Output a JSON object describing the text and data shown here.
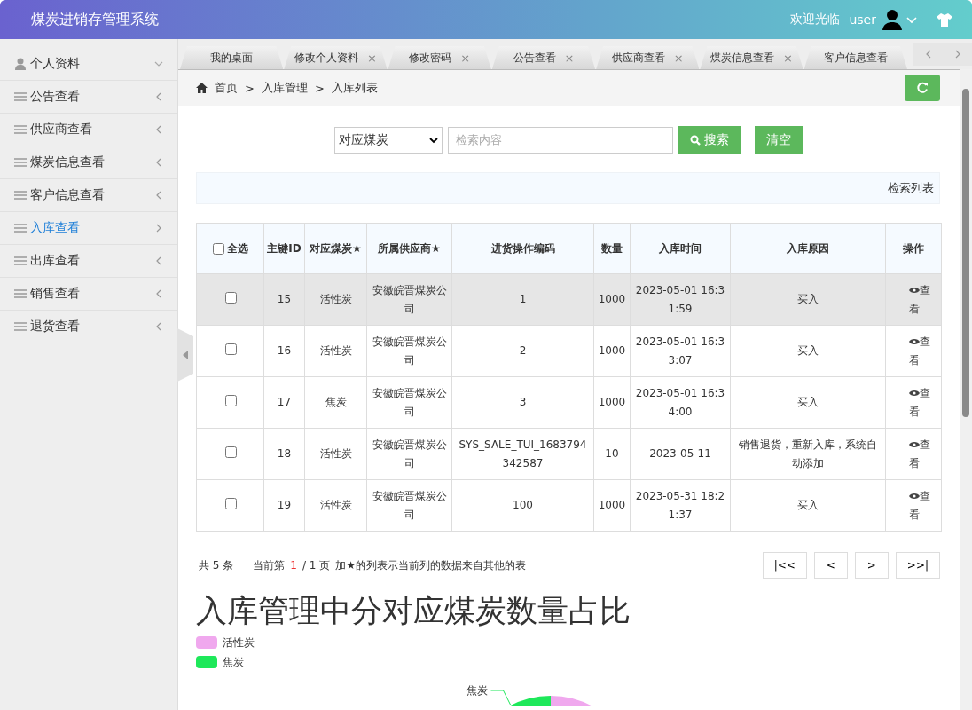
{
  "header": {
    "title": "煤炭进销存管理系统",
    "welcome": "欢迎光临",
    "user": "user"
  },
  "sidebar": {
    "items": [
      {
        "label": "个人资料",
        "kind": "profile",
        "selected": false
      },
      {
        "label": "公告查看",
        "kind": "menu",
        "selected": false
      },
      {
        "label": "供应商查看",
        "kind": "menu",
        "selected": false
      },
      {
        "label": "煤炭信息查看",
        "kind": "menu",
        "selected": false
      },
      {
        "label": "客户信息查看",
        "kind": "menu",
        "selected": false
      },
      {
        "label": "入库查看",
        "kind": "menu",
        "selected": true
      },
      {
        "label": "出库查看",
        "kind": "menu",
        "selected": false
      },
      {
        "label": "销售查看",
        "kind": "menu",
        "selected": false
      },
      {
        "label": "退货查看",
        "kind": "menu",
        "selected": false
      }
    ]
  },
  "tabs": [
    {
      "label": "我的桌面"
    },
    {
      "label": "修改个人资料",
      "close": "×"
    },
    {
      "label": "修改密码",
      "close": "×"
    },
    {
      "label": "公告查看",
      "close": "×"
    },
    {
      "label": "供应商查看",
      "close": "×"
    },
    {
      "label": "煤炭信息查看",
      "close": "×"
    },
    {
      "label": "客户信息查看"
    }
  ],
  "breadcrumb": [
    "首页",
    ">",
    "入库管理",
    ">",
    "入库列表"
  ],
  "search": {
    "select_value": "对应煤炭",
    "placeholder": "检索内容",
    "search_button": "搜索",
    "clear_button": "清空"
  },
  "list_caption": "检索列表",
  "table": {
    "select_all": "全选",
    "select_all_checked": false,
    "columns": [
      "主键ID",
      "对应煤炭★",
      "所属供应商★",
      "进货操作编码",
      "数量",
      "入库时间",
      "入库原因",
      "操作"
    ],
    "rows": [
      {
        "checked": false,
        "highlighted": true,
        "cells": [
          "15",
          "活性炭",
          "安徽皖晋煤炭公司",
          "1",
          "1000",
          "2023-05-01 16:31:59",
          "买入"
        ],
        "action": "查看"
      },
      {
        "checked": false,
        "highlighted": false,
        "cells": [
          "16",
          "活性炭",
          "安徽皖晋煤炭公司",
          "2",
          "1000",
          "2023-05-01 16:33:07",
          "买入"
        ],
        "action": "查看"
      },
      {
        "checked": false,
        "highlighted": false,
        "cells": [
          "17",
          "焦炭",
          "安徽皖晋煤炭公司",
          "3",
          "1000",
          "2023-05-01 16:34:00",
          "买入"
        ],
        "action": "查看"
      },
      {
        "checked": false,
        "highlighted": false,
        "cells": [
          "18",
          "活性炭",
          "安徽皖晋煤炭公司",
          "SYS_SALE_TUI_1683794342587",
          "10",
          "2023-05-11",
          "销售退货，重新入库，系统自动添加"
        ],
        "action": "查看"
      },
      {
        "checked": false,
        "highlighted": false,
        "cells": [
          "19",
          "活性炭",
          "安徽皖晋煤炭公司",
          "100",
          "1000",
          "2023-05-31 18:21:37",
          "买入"
        ],
        "action": "查看"
      }
    ]
  },
  "pagination": {
    "total": "共 5 条",
    "current_prefix": "当前第",
    "current_page": "1",
    "current_suffix": "/ 1 页",
    "note": "加★的列表示当前列的数据来自其他的表",
    "buttons": [
      "|<<",
      "<",
      ">",
      ">>|"
    ]
  },
  "chart": {
    "title": "入库管理中分对应煤炭数量占比",
    "legend": [
      {
        "label": "活性炭",
        "color": "#f0a8ee"
      },
      {
        "label": "焦炭",
        "color": "#1ee85a"
      }
    ],
    "pie_label": "焦炭"
  }
}
